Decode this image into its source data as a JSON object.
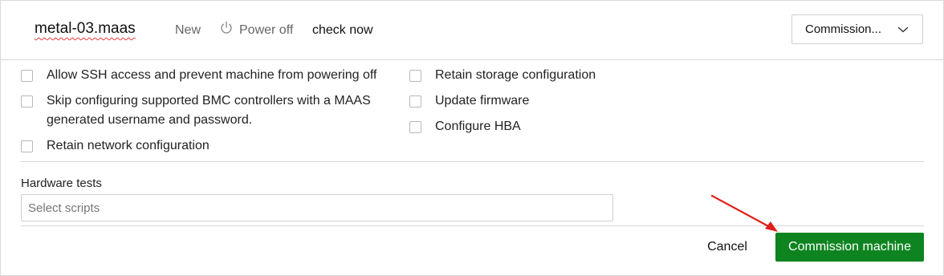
{
  "header": {
    "machine_name": "metal-03.maas",
    "status": "New",
    "power_icon": "power-icon",
    "power_state": "Power off",
    "check_now": "check now",
    "action_select": {
      "value": "Commission...",
      "icon": "chevron-down-icon"
    }
  },
  "options": {
    "left": [
      {
        "label": "Allow SSH access and prevent machine from powering off",
        "checked": false
      },
      {
        "label_line1": "Skip configuring supported BMC controllers with a MAAS",
        "label_line2": "generated username and password.",
        "checked": false
      },
      {
        "label": "Retain network configuration",
        "checked": false
      }
    ],
    "right": [
      {
        "label": "Retain storage configuration",
        "checked": false
      },
      {
        "label": "Update firmware",
        "checked": false
      },
      {
        "label": "Configure HBA",
        "checked": false
      }
    ]
  },
  "hardware_tests": {
    "label": "Hardware tests",
    "placeholder": "Select scripts",
    "value": ""
  },
  "footer": {
    "cancel_label": "Cancel",
    "submit_label": "Commission machine"
  },
  "colors": {
    "primary_button": "#0e8420",
    "annotation_arrow": "#e0201b",
    "border": "#d9d9d9"
  }
}
